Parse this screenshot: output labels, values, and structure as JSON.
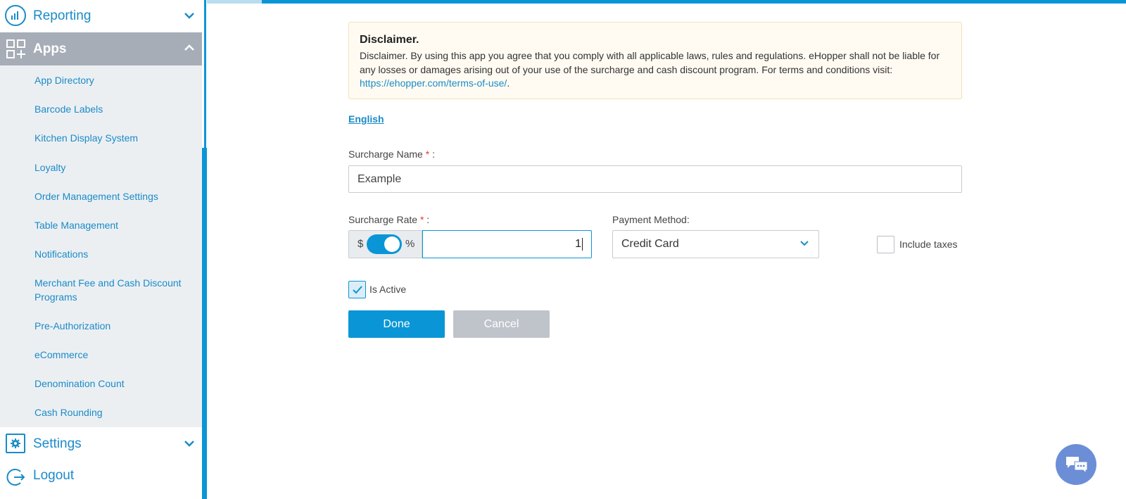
{
  "sidebar": {
    "reporting_label": "Reporting",
    "apps_label": "Apps",
    "items": [
      "App Directory",
      "Barcode Labels",
      "Kitchen Display System",
      "Loyalty",
      "Order Management Settings",
      "Table Management",
      "Notifications",
      "Merchant Fee and Cash Discount Programs",
      "Pre-Authorization",
      "eCommerce",
      "Denomination Count",
      "Cash Rounding"
    ],
    "settings_label": "Settings",
    "logout_label": "Logout"
  },
  "disclaimer": {
    "title": "Disclaimer.",
    "body": "Disclaimer. By using this app you agree that you comply with all applicable laws, rules and regulations. eHopper shall not be liable for any losses or damages arising out of your use of the surcharge and cash discount program. For terms and conditions visit: ",
    "link": "https://ehopper.com/terms-of-use/",
    "link_suffix": "."
  },
  "form": {
    "language": "English",
    "surcharge_name_label": "Surcharge Name",
    "surcharge_name_value": "Example",
    "surcharge_rate_label": "Surcharge Rate",
    "rate_dollar_symbol": "$",
    "rate_percent_symbol": "%",
    "rate_mode": "percent",
    "rate_value": "1",
    "payment_method_label": "Payment Method:",
    "payment_method_value": "Credit Card",
    "include_taxes_label": "Include taxes",
    "include_taxes_checked": false,
    "is_active_label": "Is Active",
    "is_active_checked": true,
    "required_mark": "*",
    "label_colon": ":",
    "done_label": "Done",
    "cancel_label": "Cancel"
  },
  "colors": {
    "accent": "#0a96d6",
    "sidebar_active": "#a6adb7",
    "chat_button": "#6b8ed6"
  }
}
